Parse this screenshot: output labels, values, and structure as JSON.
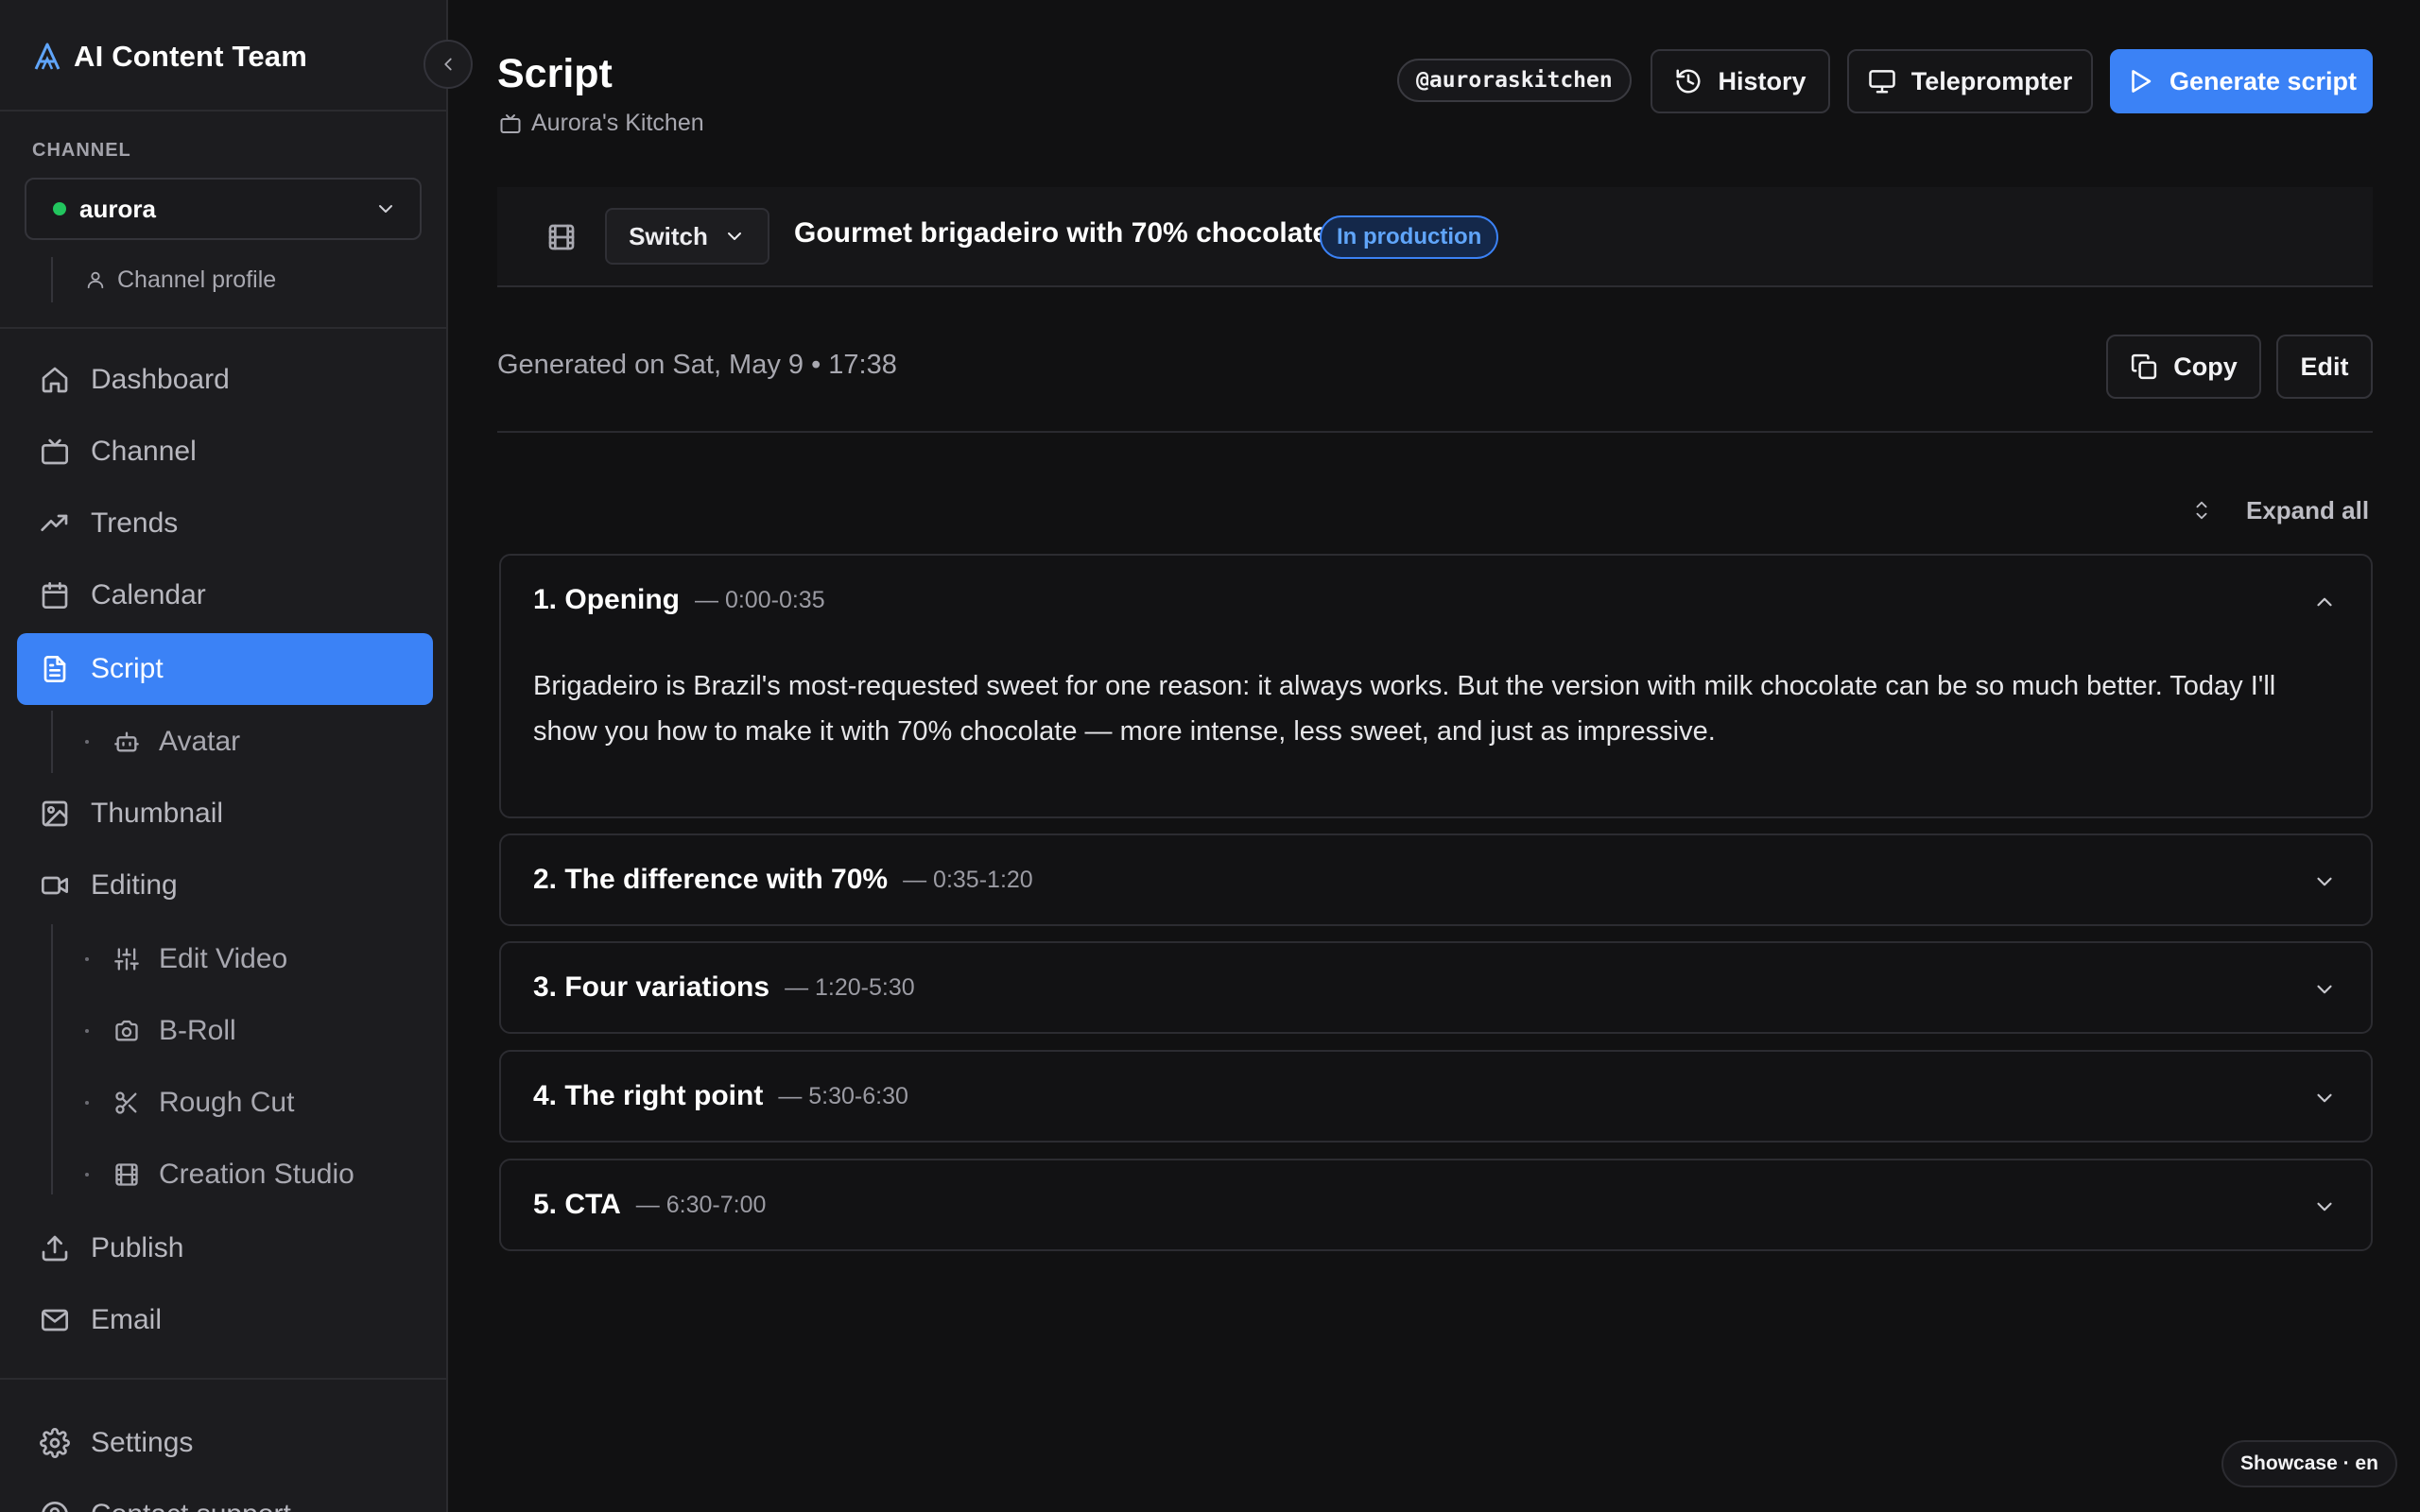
{
  "app": {
    "name": "AI Content Team"
  },
  "sidebar": {
    "channel_heading": "CHANNEL",
    "channel_value": "aurora",
    "channel_status_color": "#22c55e",
    "channel_profile": "Channel profile",
    "nav": [
      {
        "label": "Dashboard",
        "icon": "home-icon"
      },
      {
        "label": "Channel",
        "icon": "tv-icon"
      },
      {
        "label": "Trends",
        "icon": "trending-up-icon"
      },
      {
        "label": "Calendar",
        "icon": "calendar-icon"
      },
      {
        "label": "Script",
        "icon": "document-icon",
        "active": true
      },
      {
        "label": "Thumbnail",
        "icon": "image-icon"
      },
      {
        "label": "Editing",
        "icon": "video-camera-icon"
      },
      {
        "label": "Publish",
        "icon": "upload-icon"
      },
      {
        "label": "Email",
        "icon": "mail-icon"
      },
      {
        "label": "Settings",
        "icon": "gear-icon"
      },
      {
        "label": "Contact support",
        "icon": "support-icon"
      }
    ],
    "script_sub": [
      {
        "label": "Avatar",
        "icon": "bot-icon"
      }
    ],
    "editing_sub": [
      {
        "label": "Edit Video",
        "icon": "sliders-icon"
      },
      {
        "label": "B-Roll",
        "icon": "camera-icon"
      },
      {
        "label": "Rough Cut",
        "icon": "scissors-icon"
      },
      {
        "label": "Creation Studio",
        "icon": "film-icon"
      }
    ]
  },
  "header": {
    "title": "Script",
    "subtitle": "Aurora's Kitchen",
    "handle": "@auroraskitchen",
    "history_label": "History",
    "teleprompter_label": "Teleprompter",
    "generate_label": "Generate script"
  },
  "video": {
    "switch_label": "Switch",
    "title": "Gourmet brigadeiro with 70% chocolate",
    "status": "In production"
  },
  "script": {
    "generated_on": "Generated on Sat, May 9 • 17:38",
    "copy_label": "Copy",
    "edit_label": "Edit",
    "expand_all_label": "Expand all",
    "sections": [
      {
        "title": "1. Opening",
        "time": "— 0:00-0:35",
        "expanded": true,
        "body": "Brigadeiro is Brazil's most-requested sweet for one reason: it always works. But the version with milk chocolate can be so much better. Today I'll show you how to make it with 70% chocolate — more intense, less sweet, and just as impressive."
      },
      {
        "title": "2. The difference with 70%",
        "time": "— 0:35-1:20",
        "expanded": false
      },
      {
        "title": "3. Four variations",
        "time": "— 1:20-5:30",
        "expanded": false
      },
      {
        "title": "4. The right point",
        "time": "— 5:30-6:30",
        "expanded": false
      },
      {
        "title": "5. CTA",
        "time": "— 6:30-7:00",
        "expanded": false
      }
    ]
  },
  "footer": {
    "showcase_badge": "Showcase · en"
  },
  "colors": {
    "accent": "#3b82f6",
    "status_blue": "#60a5fa",
    "background": "#111112",
    "sidebar": "#1c1c1f"
  }
}
